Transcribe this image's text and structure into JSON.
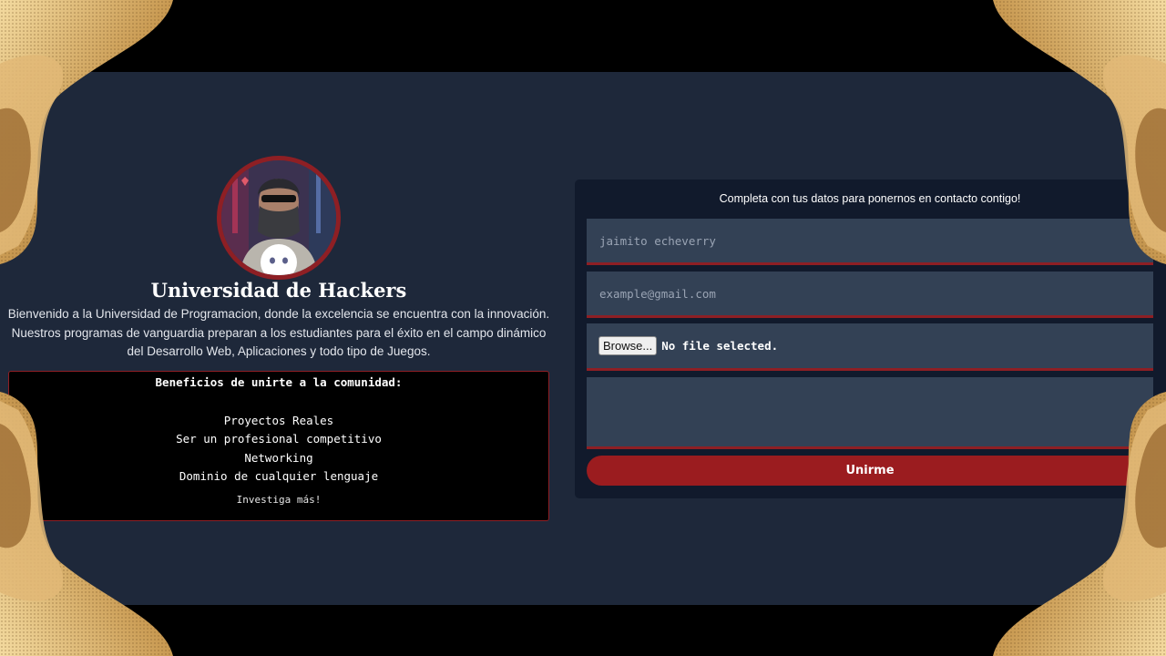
{
  "header": {
    "title": "Universidad de Hackers",
    "intro": "Bienvenido a la Universidad de Programacion, donde la excelencia se encuentra con la innovación. Nuestros programas de vanguardia preparan a los estudiantes para el éxito en el campo dinámico del Desarrollo Web, Aplicaciones y todo tipo de Juegos."
  },
  "benefits": {
    "heading": "Beneficios de unirte a la comunidad:",
    "items": [
      "Proyectos Reales",
      "Ser un profesional competitivo",
      "Networking",
      "Dominio de cualquier lenguaje"
    ],
    "more_link": "Investiga más!"
  },
  "form": {
    "prompt": "Completa con tus datos para ponernos en contacto contigo!",
    "name_placeholder": "jaimito echeverry",
    "email_placeholder": "example@gmail.com",
    "browse_label": "Browse...",
    "file_status": "No file selected.",
    "message_placeholder": "",
    "submit_label": "Unirme"
  },
  "colors": {
    "page_background": "#000000",
    "panel": "#1e283a",
    "form_card": "#111a2c",
    "field": "#334155",
    "accent_red": "#9b1c1f",
    "gold": "#c9a060"
  },
  "icons": {
    "avatar_badge": "discord-icon",
    "decoration": "gold-wave-ornament"
  }
}
